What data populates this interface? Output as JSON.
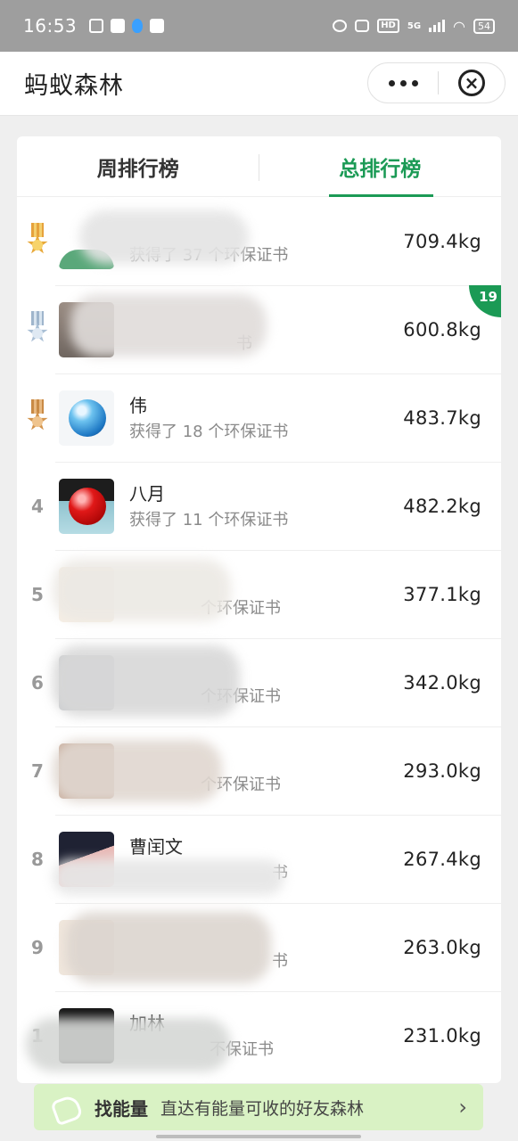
{
  "status": {
    "time": "16:53",
    "network": "5G",
    "hd": "HD",
    "battery": "54"
  },
  "header": {
    "title": "蚂蚁森林"
  },
  "tabs": [
    {
      "label": "周排行榜",
      "active": false
    },
    {
      "label": "总排行榜",
      "active": true
    }
  ],
  "rows": [
    {
      "rank": "",
      "medal": "gold",
      "name": "",
      "sub": "获得了 37 个环保证书",
      "weight": "709.4kg"
    },
    {
      "rank": "",
      "medal": "silver",
      "name": "",
      "sub": "书",
      "weight": "600.8kg",
      "badge": "19"
    },
    {
      "rank": "",
      "medal": "bronze",
      "name": "伟",
      "sub": "获得了 18 个环保证书",
      "weight": "483.7kg"
    },
    {
      "rank": "4",
      "name": "八月",
      "sub": "获得了 11 个环保证书",
      "weight": "482.2kg"
    },
    {
      "rank": "5",
      "name": "",
      "sub": "个环保证书",
      "weight": "377.1kg"
    },
    {
      "rank": "6",
      "name": "",
      "sub": "个环保证书",
      "weight": "342.0kg"
    },
    {
      "rank": "7",
      "name": "",
      "sub": "个环保证书",
      "weight": "293.0kg"
    },
    {
      "rank": "8",
      "name": "曹闰文",
      "sub": "书",
      "weight": "267.4kg"
    },
    {
      "rank": "9",
      "name": "",
      "sub": "书",
      "weight": "263.0kg"
    },
    {
      "rank": "1",
      "name": "加林",
      "sub": "不保证书",
      "weight": "231.0kg"
    }
  ],
  "banner": {
    "strong": "找能量",
    "text": "直达有能量可收的好友森林",
    "chevron": "›"
  }
}
